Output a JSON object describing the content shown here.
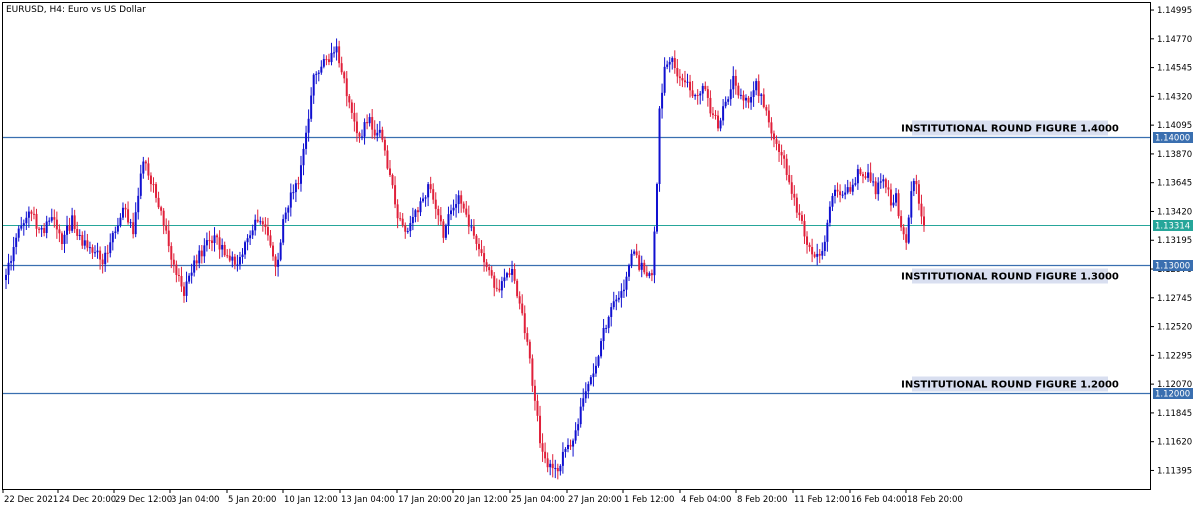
{
  "chart_data": {
    "type": "candlestick",
    "title": "EURUSD, H4:  Euro vs US Dollar",
    "colors": {
      "bull": "#1010d0",
      "bear": "#e0203a",
      "level_line": "#3a6fb0",
      "current_line": "#26a69a",
      "level_box_bg": "#d9dff0",
      "price_tag_bg": "#3a6fb0",
      "current_tag_bg": "#26a69a",
      "frame": "#000000"
    },
    "y_axis": {
      "min": 1.1125,
      "max": 1.1505,
      "ticks": [
        "1.14995",
        "1.14770",
        "1.14545",
        "1.14320",
        "1.14095",
        "1.13870",
        "1.13645",
        "1.13420",
        "1.13195",
        "1.12970",
        "1.12745",
        "1.12520",
        "1.12295",
        "1.12070",
        "1.11845",
        "1.11620",
        "1.11395"
      ]
    },
    "x_axis": {
      "labels": [
        "22 Dec 2021",
        "24 Dec 20:00",
        "29 Dec 12:00",
        "3 Jan 04:00",
        "5 Jan 20:00",
        "10 Jan 12:00",
        "13 Jan 04:00",
        "17 Jan 20:00",
        "20 Jan 12:00",
        "25 Jan 04:00",
        "27 Jan 20:00",
        "1 Feb 12:00",
        "4 Feb 04:00",
        "8 Feb 20:00",
        "11 Feb 12:00",
        "16 Feb 04:00",
        "18 Feb 20:00"
      ]
    },
    "current_price": "1.13314",
    "levels": [
      {
        "price": "1.14000",
        "label": "INSTITUTIONAL ROUND FIGURE 1.4000",
        "label_position": "above"
      },
      {
        "price": "1.13000",
        "label": "INSTITUTIONAL ROUND FIGURE 1.3000",
        "label_position": "below"
      },
      {
        "price": "1.12000",
        "label": "INSTITUTIONAL ROUND FIGURE 1.2000",
        "label_position": "above"
      }
    ],
    "anchors": [
      [
        0,
        1.129
      ],
      [
        3,
        1.1315
      ],
      [
        6,
        1.133
      ],
      [
        10,
        1.134
      ],
      [
        14,
        1.1325
      ],
      [
        18,
        1.1338
      ],
      [
        22,
        1.132
      ],
      [
        26,
        1.1335
      ],
      [
        30,
        1.1318
      ],
      [
        34,
        1.1312
      ],
      [
        38,
        1.1302
      ],
      [
        42,
        1.1325
      ],
      [
        46,
        1.1345
      ],
      [
        50,
        1.1325
      ],
      [
        54,
        1.1385
      ],
      [
        58,
        1.136
      ],
      [
        62,
        1.1335
      ],
      [
        66,
        1.13
      ],
      [
        70,
        1.128
      ],
      [
        74,
        1.13
      ],
      [
        78,
        1.1315
      ],
      [
        82,
        1.1322
      ],
      [
        86,
        1.131
      ],
      [
        90,
        1.13
      ],
      [
        94,
        1.1315
      ],
      [
        98,
        1.1335
      ],
      [
        102,
        1.133
      ],
      [
        106,
        1.1295
      ],
      [
        110,
        1.1345
      ],
      [
        114,
        1.136
      ],
      [
        116,
        1.1375
      ],
      [
        118,
        1.14
      ],
      [
        121,
        1.1445
      ],
      [
        124,
        1.1455
      ],
      [
        127,
        1.146
      ],
      [
        130,
        1.147
      ],
      [
        133,
        1.1445
      ],
      [
        136,
        1.142
      ],
      [
        139,
        1.14
      ],
      [
        142,
        1.1415
      ],
      [
        145,
        1.1405
      ],
      [
        148,
        1.14
      ],
      [
        151,
        1.137
      ],
      [
        154,
        1.134
      ],
      [
        157,
        1.1325
      ],
      [
        160,
        1.1335
      ],
      [
        163,
        1.135
      ],
      [
        166,
        1.136
      ],
      [
        169,
        1.1345
      ],
      [
        172,
        1.1325
      ],
      [
        175,
        1.1345
      ],
      [
        178,
        1.1355
      ],
      [
        181,
        1.134
      ],
      [
        184,
        1.132
      ],
      [
        187,
        1.131
      ],
      [
        190,
        1.1292
      ],
      [
        193,
        1.128
      ],
      [
        196,
        1.129
      ],
      [
        199,
        1.13
      ],
      [
        201,
        1.1275
      ],
      [
        204,
        1.125
      ],
      [
        207,
        1.121
      ],
      [
        210,
        1.1165
      ],
      [
        213,
        1.1145
      ],
      [
        216,
        1.114
      ],
      [
        219,
        1.115
      ],
      [
        222,
        1.116
      ],
      [
        225,
        1.118
      ],
      [
        228,
        1.12
      ],
      [
        231,
        1.1215
      ],
      [
        234,
        1.124
      ],
      [
        237,
        1.126
      ],
      [
        240,
        1.1275
      ],
      [
        243,
        1.1285
      ],
      [
        246,
        1.131
      ],
      [
        249,
        1.13
      ],
      [
        252,
        1.1295
      ],
      [
        254,
        1.129
      ],
      [
        256,
        1.136
      ],
      [
        257,
        1.142
      ],
      [
        259,
        1.1455
      ],
      [
        262,
        1.146
      ],
      [
        265,
        1.1445
      ],
      [
        268,
        1.144
      ],
      [
        271,
        1.143
      ],
      [
        274,
        1.144
      ],
      [
        277,
        1.142
      ],
      [
        280,
        1.141
      ],
      [
        283,
        1.1425
      ],
      [
        286,
        1.1445
      ],
      [
        289,
        1.143
      ],
      [
        292,
        1.1425
      ],
      [
        295,
        1.144
      ],
      [
        298,
        1.1425
      ],
      [
        301,
        1.14
      ],
      [
        304,
        1.139
      ],
      [
        307,
        1.1375
      ],
      [
        310,
        1.135
      ],
      [
        312,
        1.134
      ],
      [
        315,
        1.1315
      ],
      [
        318,
        1.1305
      ],
      [
        321,
        1.131
      ],
      [
        324,
        1.1345
      ],
      [
        327,
        1.136
      ],
      [
        330,
        1.1355
      ],
      [
        333,
        1.1365
      ],
      [
        336,
        1.1375
      ],
      [
        339,
        1.137
      ],
      [
        342,
        1.136
      ],
      [
        345,
        1.1365
      ],
      [
        348,
        1.135
      ],
      [
        350,
        1.1355
      ],
      [
        352,
        1.133
      ],
      [
        354,
        1.132
      ],
      [
        356,
        1.1362
      ],
      [
        358,
        1.1365
      ],
      [
        359,
        1.1345
      ],
      [
        361,
        1.1331
      ]
    ]
  }
}
